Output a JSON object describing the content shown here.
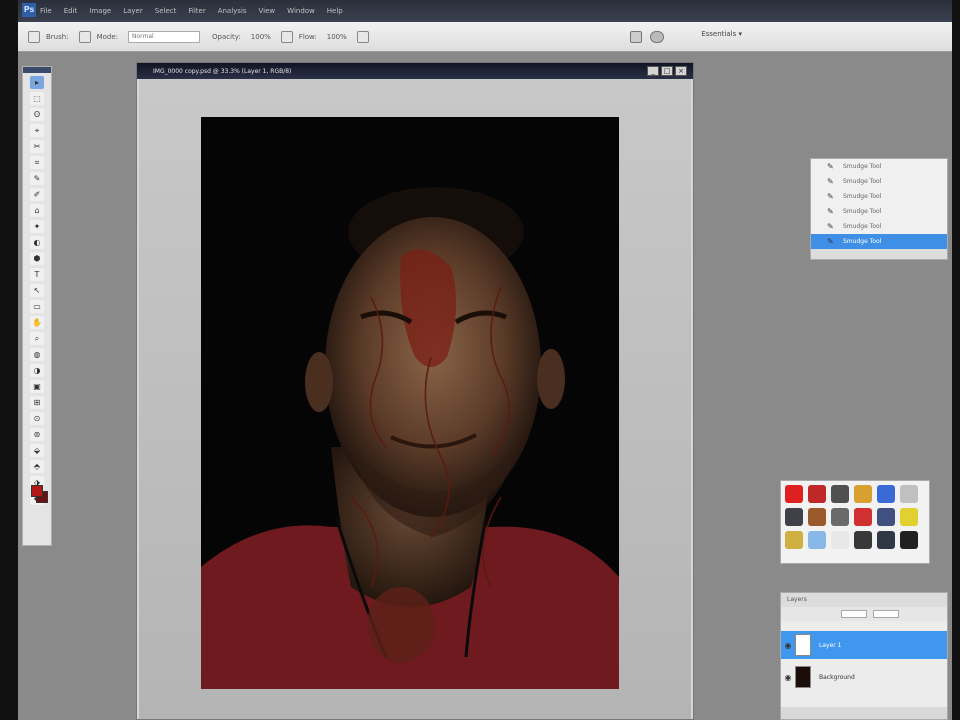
{
  "app": {
    "logo": "Ps",
    "menus": [
      "File",
      "Edit",
      "Image",
      "Layer",
      "Select",
      "Filter",
      "Analysis",
      "View",
      "Window",
      "Help"
    ],
    "workspace": "Essentials ▾"
  },
  "options_bar": {
    "brush_label": "Brush:",
    "mode_label": "Mode:",
    "mode_value": "Normal",
    "opacity_label": "Opacity:",
    "opacity_value": "100%",
    "flow_label": "Flow:",
    "flow_value": "100%"
  },
  "document": {
    "title": "IMG_0000 copy.psd @ 33.3% (Layer 1, RGB/8)",
    "btn_minimize": "_",
    "btn_maximize": "□",
    "btn_close": "×"
  },
  "tools": [
    "▸",
    "⬚",
    "ʘ",
    "⌖",
    "✂",
    "⌗",
    "✎",
    "✐",
    "⌂",
    "✦",
    "◐",
    "⬢",
    "T",
    "↖",
    "▭",
    "✋",
    "⌕",
    "◍",
    "◑",
    "▣",
    "⊞",
    "⊙",
    "⊚",
    "⬙",
    "⬘",
    "⬗",
    "⬖"
  ],
  "history": {
    "items": [
      {
        "label": "Smudge Tool",
        "selected": false
      },
      {
        "label": "Smudge Tool",
        "selected": false
      },
      {
        "label": "Smudge Tool",
        "selected": false
      },
      {
        "label": "Smudge Tool",
        "selected": false
      },
      {
        "label": "Smudge Tool",
        "selected": false
      },
      {
        "label": "Smudge Tool",
        "selected": true
      }
    ]
  },
  "swatches": {
    "colors": [
      "#e02020",
      "#c02828",
      "#505050",
      "#d8a030",
      "#3a6ad8",
      "#c0c0c0",
      "#404048",
      "#9a5a2a",
      "#6a6a6a",
      "#d03030",
      "#405080",
      "#e0d030",
      "#d0b040",
      "#88b8e8",
      "#e8e8e8",
      "#383838",
      "#303848",
      "#202020"
    ]
  },
  "layers": {
    "tab_label": "Layers",
    "layer_names": [
      "Layer 1",
      "Background"
    ]
  }
}
